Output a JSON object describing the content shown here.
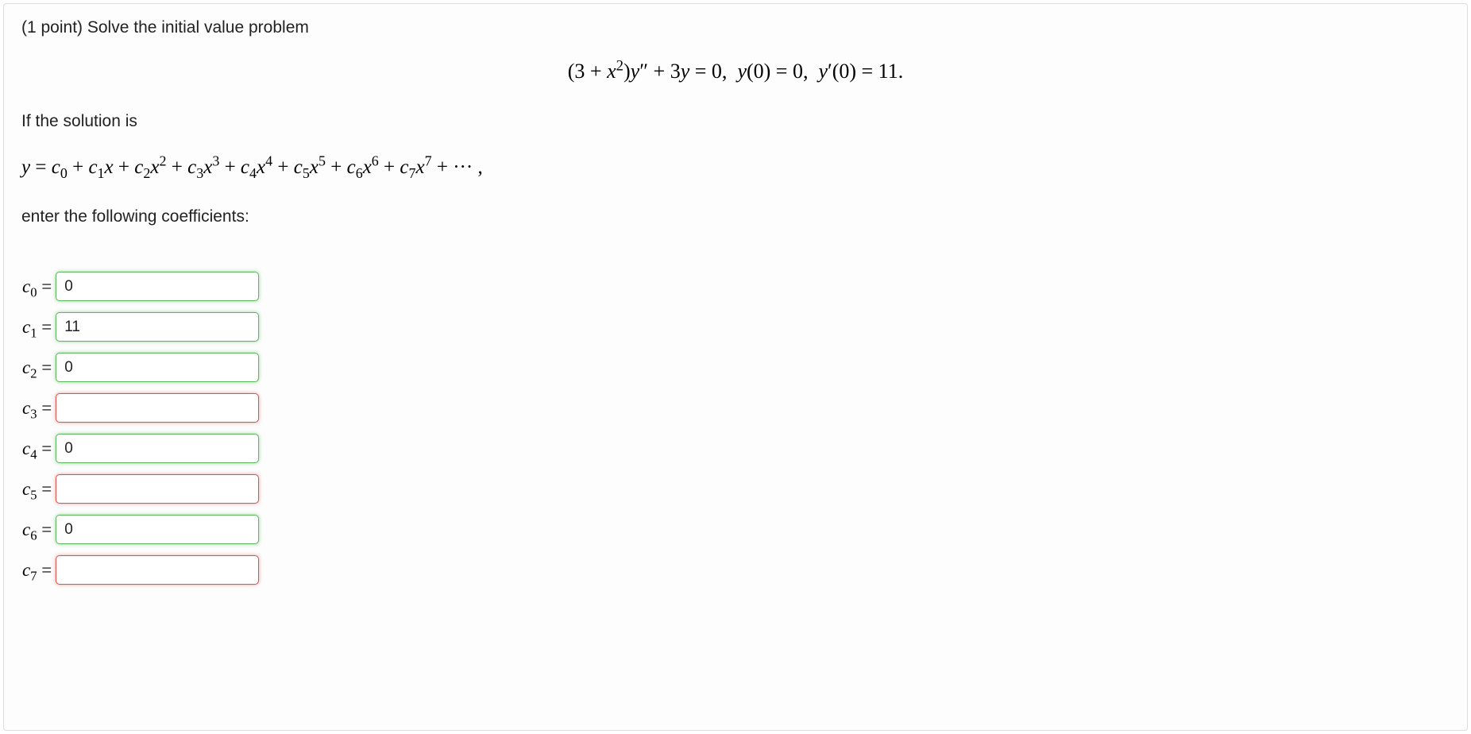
{
  "problem": {
    "points_prefix": "(1 point) ",
    "prompt": "Solve the initial value problem",
    "equation_html": "(3 + <span class='ital'>x</span><sup>2</sup>)<span class='ital'>y</span>&Prime; + 3<span class='ital'>y</span> = 0,&nbsp; <span class='ital'>y</span>(0) = 0,&nbsp; <span class='ital'>y</span>&prime;(0) = 11.",
    "if_solution": "If the solution is",
    "series_html": "<span class='ital'>y</span> = <span class='ital'>c</span><sub>0</sub> + <span class='ital'>c</span><sub>1</sub><span class='ital'>x</span> + <span class='ital'>c</span><sub>2</sub><span class='ital'>x</span><sup>2</sup> + <span class='ital'>c</span><sub>3</sub><span class='ital'>x</span><sup>3</sup> + <span class='ital'>c</span><sub>4</sub><span class='ital'>x</span><sup>4</sup> + <span class='ital'>c</span><sub>5</sub><span class='ital'>x</span><sup>5</sup> + <span class='ital'>c</span><sub>6</sub><span class='ital'>x</span><sup>6</sup> + <span class='ital'>c</span><sub>7</sub><span class='ital'>x</span><sup>7</sup> + &middot;&middot;&middot; ,",
    "enter_text": "enter the following coefficients:"
  },
  "coefficients": [
    {
      "label_html": "<span class='ital'>c</span><sub>0</sub>&nbsp;=",
      "value": "0",
      "status": "correct"
    },
    {
      "label_html": "<span class='ital'>c</span><sub>1</sub>&nbsp;=",
      "value": "11",
      "status": "correct"
    },
    {
      "label_html": "<span class='ital'>c</span><sub>2</sub>&nbsp;=",
      "value": "0",
      "status": "correct"
    },
    {
      "label_html": "<span class='ital'>c</span><sub>3</sub>&nbsp;=",
      "value": "",
      "status": "incorrect"
    },
    {
      "label_html": "<span class='ital'>c</span><sub>4</sub>&nbsp;=",
      "value": "0",
      "status": "correct"
    },
    {
      "label_html": "<span class='ital'>c</span><sub>5</sub>&nbsp;=",
      "value": "",
      "status": "incorrect"
    },
    {
      "label_html": "<span class='ital'>c</span><sub>6</sub>&nbsp;=",
      "value": "0",
      "status": "correct"
    },
    {
      "label_html": "<span class='ital'>c</span><sub>7</sub>&nbsp;=",
      "value": "",
      "status": "incorrect"
    }
  ]
}
